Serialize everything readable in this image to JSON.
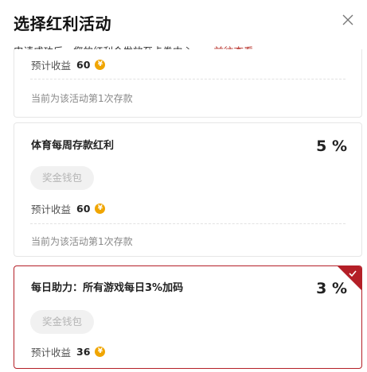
{
  "dialog": {
    "title": "选择红利活动",
    "subtitle": "申请成功后，您的红利会发放至卡券中心。",
    "view_link": "前往查看"
  },
  "cards": [
    {
      "name": "",
      "percent": "",
      "wallet_button": "",
      "earnings_label": "预计收益",
      "earnings_value": "60",
      "coin_symbol": "¥",
      "note": "当前为该活动第1次存款",
      "selected": false
    },
    {
      "name": "体育每周存款红利",
      "percent": "5 %",
      "wallet_button": "奖金钱包",
      "earnings_label": "预计收益",
      "earnings_value": "60",
      "coin_symbol": "¥",
      "note": "当前为该活动第1次存款",
      "selected": false
    },
    {
      "name": "每日助力：所有游戏每日3%加码",
      "percent": "3 %",
      "wallet_button": "奖金钱包",
      "earnings_label": "预计收益",
      "earnings_value": "36",
      "coin_symbol": "¥",
      "note": "",
      "selected": true
    }
  ],
  "colors": {
    "accent": "#b41f27",
    "link": "#b8332c",
    "coin": "#f0a500"
  }
}
